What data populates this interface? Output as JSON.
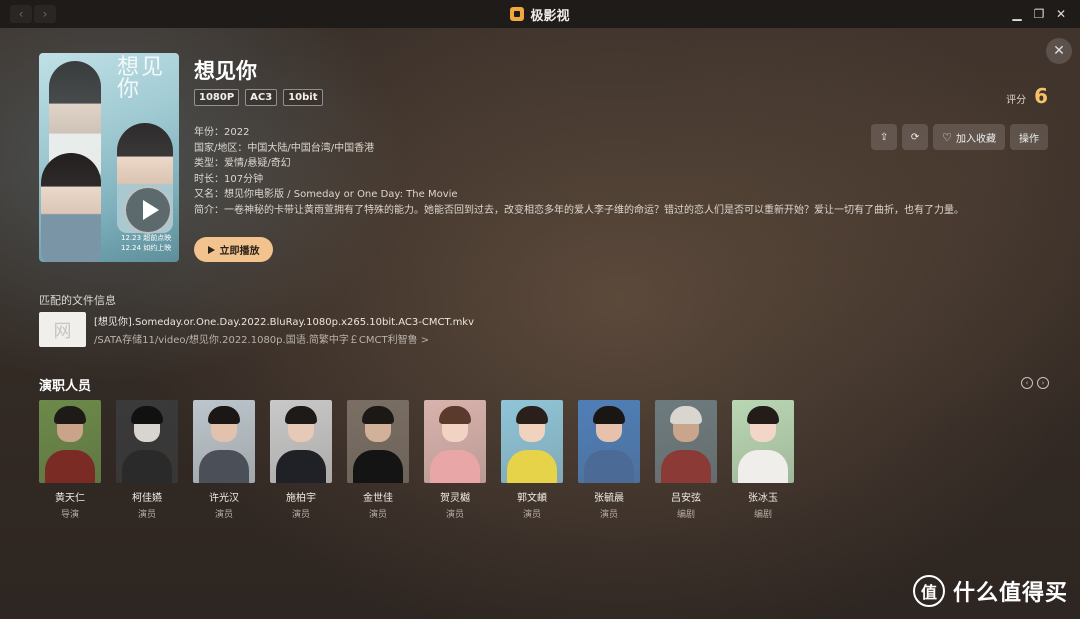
{
  "window": {
    "app_title": "极影视",
    "controls": [
      "minimize",
      "restore",
      "close"
    ]
  },
  "movie": {
    "title": "想见你",
    "badges": [
      "1080P",
      "AC3",
      "10bit"
    ],
    "rating_label": "评分",
    "rating_value": "6",
    "poster": {
      "title_art": "想见你",
      "date_text": "12.23 超前点映 12.24 如约上映"
    },
    "info": {
      "year": "年份：2022",
      "country": "国家/地区：中国大陆/中国台湾/中国香港",
      "genre": "类型：爱情/悬疑/奇幻",
      "duration": "时长：107分钟",
      "alias": "又名：想见你电影版 / Someday or One Day: The Movie",
      "synopsis": "简介：一卷神秘的卡带让黄雨萱拥有了特殊的能力。她能否回到过去，改变相恋多年的爱人李子维的命运？错过的恋人们是否可以重新开始？爱让一切有了曲折，也有了力量。"
    },
    "actions": {
      "favorite_label": "加入收藏",
      "operate_label": "操作"
    },
    "play_label": "立即播放"
  },
  "file": {
    "section_label": "匹配的文件信息",
    "name": "[想见你].Someday.or.One.Day.2022.BluRay.1080p.x265.10bit.AC3-CMCT.mkv",
    "path": "/SATA存储11/video/想见你.2022.1080p.国语.简繁中字￡CMCT利智鲁 >"
  },
  "cast": {
    "title": "演职人员",
    "members": [
      {
        "name": "黄天仁",
        "role": "导演",
        "skin": "#caa48a",
        "hair": "#1e1a18",
        "body": "#7a2b24",
        "bg": "#6c8a4a"
      },
      {
        "name": "柯佳嬿",
        "role": "演员",
        "skin": "#d8d4d0",
        "hair": "#111111",
        "body": "#2a2a2a",
        "bg": "#3a3a3a"
      },
      {
        "name": "许光汉",
        "role": "演员",
        "skin": "#e2c2ac",
        "hair": "#1b1714",
        "body": "#4b5058",
        "bg": "#bcc6cc"
      },
      {
        "name": "施柏宇",
        "role": "演员",
        "skin": "#e6c9b6",
        "hair": "#1d1a18",
        "body": "#1f2126",
        "bg": "#c9c9c9"
      },
      {
        "name": "金世佳",
        "role": "演员",
        "skin": "#d2b19b",
        "hair": "#1c1816",
        "body": "#141414",
        "bg": "#7a6f64"
      },
      {
        "name": "贺灵樾",
        "role": "演员",
        "skin": "#f0d3c3",
        "hair": "#5a3a2c",
        "body": "#e8a7a6",
        "bg": "#d9b3ae"
      },
      {
        "name": "郭文頔",
        "role": "演员",
        "skin": "#f1d2bf",
        "hair": "#2a1f1a",
        "body": "#e6d34a",
        "bg": "#8fc5d8"
      },
      {
        "name": "张毓晨",
        "role": "演员",
        "skin": "#e6c2ad",
        "hair": "#1a1614",
        "body": "#4b6b96",
        "bg": "#4f7fb8"
      },
      {
        "name": "吕安弦",
        "role": "编剧",
        "skin": "#c9a58b",
        "hair": "#d9d5cf",
        "body": "#8c3a36",
        "bg": "#6d7b7e"
      },
      {
        "name": "张冰玉",
        "role": "编剧",
        "skin": "#f2d6c8",
        "hair": "#241c18",
        "body": "#f0eeea",
        "bg": "#b9d7b4"
      }
    ]
  },
  "watermark": {
    "logo_glyph": "值",
    "text": "什么值得买"
  }
}
